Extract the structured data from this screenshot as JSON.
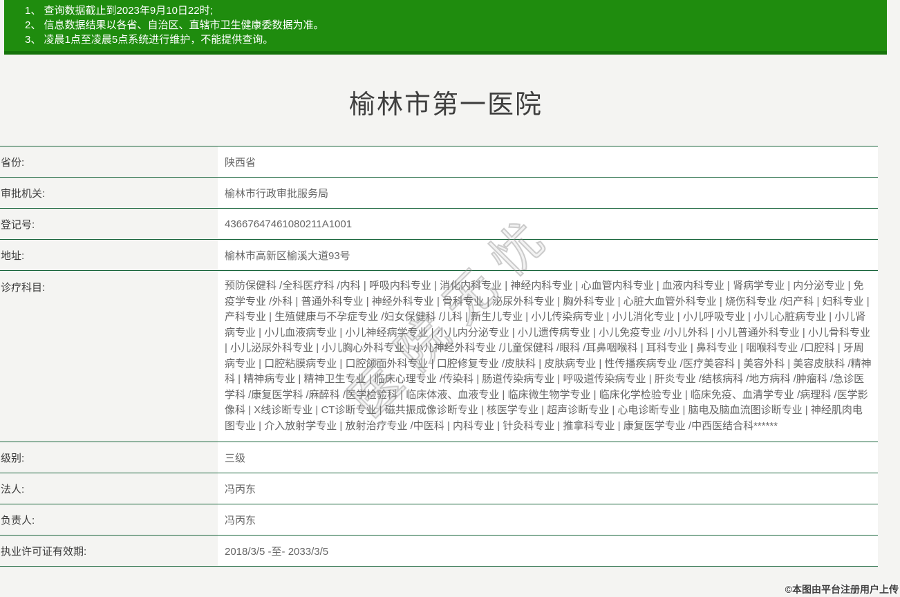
{
  "notice": {
    "lines": [
      "1、 查询数据截止到2023年9月10日22时;",
      "2、 信息数据结果以各省、自治区、直辖市卫生健康委数据为准。",
      "3、 凌晨1点至凌晨5点系统进行维护，不能提供查询。"
    ]
  },
  "hospital": {
    "title": "榆林市第一医院"
  },
  "table": {
    "rows": [
      {
        "label": "省份:",
        "value": "陕西省"
      },
      {
        "label": "审批机关:",
        "value": "榆林市行政审批服务局"
      },
      {
        "label": "登记号:",
        "value": "43667647461080211A1001"
      },
      {
        "label": "地址:",
        "value": "榆林市高新区榆溪大道93号"
      },
      {
        "label": "诊疗科目:",
        "value": "预防保健科 /全科医疗科 /内科 | 呼吸内科专业 | 消化内科专业 | 神经内科专业 | 心血管内科专业 | 血液内科专业 | 肾病学专业 | 内分泌专业 | 免疫学专业 /外科 | 普通外科专业 | 神经外科专业 | 骨科专业 | 泌尿外科专业 | 胸外科专业 | 心脏大血管外科专业 | 烧伤科专业 /妇产科 | 妇科专业 | 产科专业 | 生殖健康与不孕症专业 /妇女保健科 /儿科 | 新生儿专业 | 小儿传染病专业 | 小儿消化专业 | 小儿呼吸专业 | 小儿心脏病专业 | 小儿肾病专业 | 小儿血液病专业 | 小儿神经病学专业 | 小儿内分泌专业 | 小儿遗传病专业 | 小儿免疫专业 /小儿外科 | 小儿普通外科专业 | 小儿骨科专业 | 小儿泌尿外科专业 | 小儿胸心外科专业 | 小儿神经外科专业 /儿童保健科 /眼科 /耳鼻咽喉科 | 耳科专业 | 鼻科专业 | 咽喉科专业 /口腔科 | 牙周病专业 | 口腔粘膜病专业 | 口腔颌面外科专业 | 口腔修复专业 /皮肤科 | 皮肤病专业 | 性传播疾病专业 /医疗美容科 | 美容外科 | 美容皮肤科 /精神科 | 精神病专业 | 精神卫生专业 | 临床心理专业 /传染科 | 肠道传染病专业 | 呼吸道传染病专业 | 肝炎专业 /结核病科 /地方病科 /肿瘤科 /急诊医学科 /康复医学科 /麻醉科 /医学检验科 | 临床体液、血液专业 | 临床微生物学专业 | 临床化学检验专业 | 临床免疫、血清学专业 /病理科 /医学影像科 | X线诊断专业 | CT诊断专业 | 磁共振成像诊断专业 | 核医学专业 | 超声诊断专业 | 心电诊断专业 | 脑电及脑血流图诊断专业 | 神经肌肉电图专业 | 介入放射学专业 | 放射治疗专业 /中医科 | 内科专业 | 针灸科专业 | 推拿科专业 | 康复医学专业 /中西医结合科******"
      },
      {
        "label": "级别:",
        "value": "三级"
      },
      {
        "label": "法人:",
        "value": "冯丙东"
      },
      {
        "label": "负责人:",
        "value": "冯丙东"
      },
      {
        "label": "执业许可证有效期:",
        "value": "2018/3/5 -至- 2033/3/5"
      }
    ]
  },
  "watermarks": {
    "diagonal": "医院无忧",
    "corner": "©本图由平台注册用户上传"
  },
  "colors": {
    "banner_green": "#1f8c0e",
    "banner_green_dark": "#15730a",
    "divider_green": "#166339",
    "page_background": "#f4f4f2"
  }
}
